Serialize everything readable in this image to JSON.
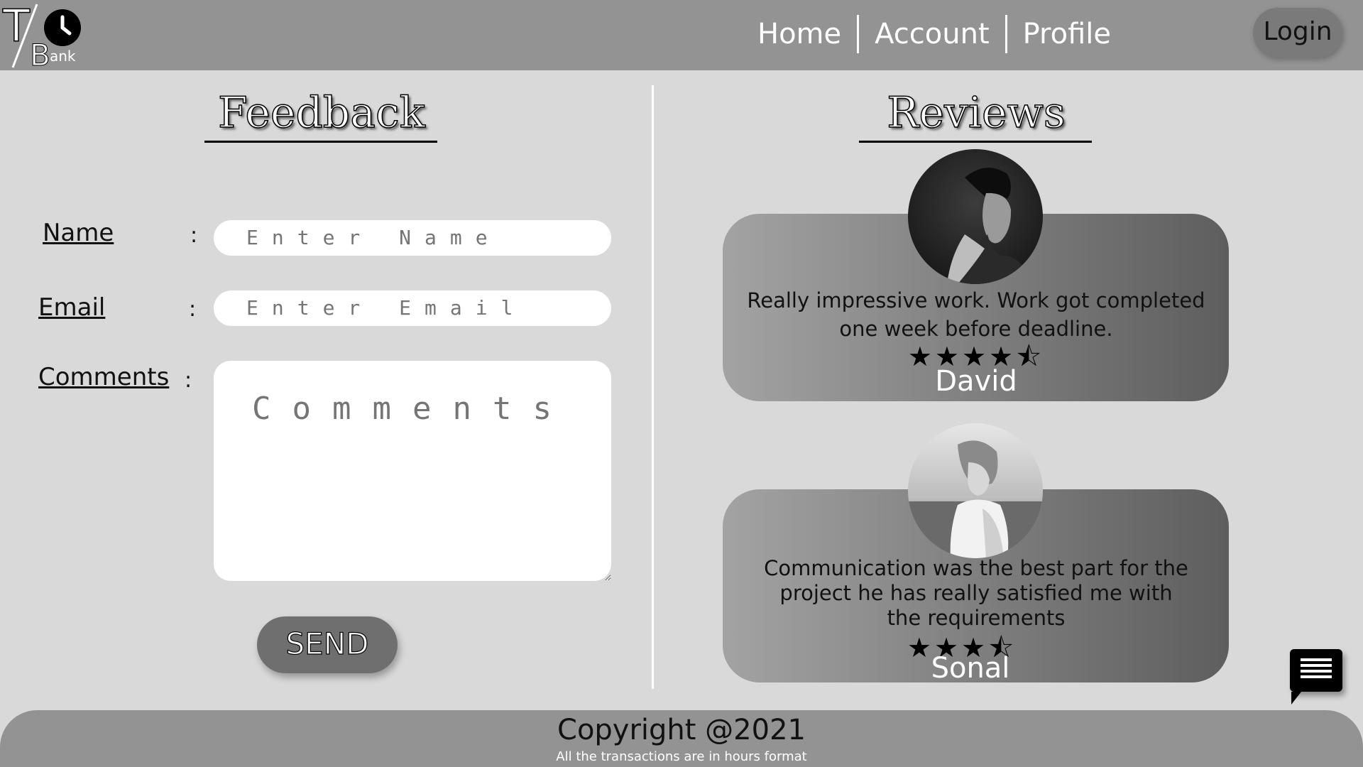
{
  "brand": {
    "letters_top": "T",
    "letters_bottom": "B",
    "suffix": "ank"
  },
  "nav": {
    "items": [
      {
        "label": "Home"
      },
      {
        "label": "Account"
      },
      {
        "label": "Profile"
      }
    ],
    "login_label": "Login"
  },
  "feedback": {
    "title": "Feedback",
    "name_label": "Name",
    "email_label": "Email",
    "comments_label": "Comments",
    "colon": ":",
    "name_placeholder": "Enter Name",
    "email_placeholder": "Enter Email",
    "comments_placeholder": "Comments",
    "send_label": "SEND"
  },
  "reviews": {
    "title": "Reviews",
    "items": [
      {
        "text": "Really impressive work. Work got completed one week before deadline.",
        "stars": "★★★★⯪",
        "rating": 4.5,
        "name": "David"
      },
      {
        "text": "Communication was the best part for the project he has really satisfied me with the requirements",
        "stars": "★★★⯪",
        "rating": 3.5,
        "name": "Sonal"
      }
    ]
  },
  "footer": {
    "copyright": "Copyright @2021",
    "note": "All the transactions are in hours format"
  },
  "icons": {
    "chat": "chat-icon",
    "clock": "clock-icon"
  },
  "colors": {
    "header": "#939393",
    "background": "#d9d9d9",
    "accent_button": "#6f6f6f"
  }
}
